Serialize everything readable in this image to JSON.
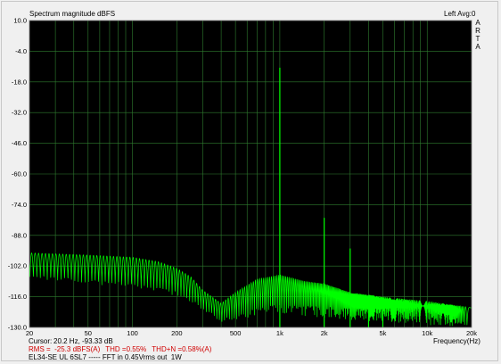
{
  "header": {
    "title": "Spectrum magnitude dBFS",
    "channel": "Left  Avg:0",
    "brand": [
      "A",
      "R",
      "T",
      "A"
    ]
  },
  "chart_data": {
    "type": "line",
    "title": "Spectrum magnitude dBFS",
    "xlabel": "Frequency(Hz)",
    "ylabel": "",
    "x_scale": "log",
    "xlim": [
      20,
      20000
    ],
    "ylim": [
      -130,
      10
    ],
    "grid": true,
    "y_ticks": [
      "10.0",
      "-4.0",
      "-18.0",
      "-32.0",
      "-46.0",
      "-60.0",
      "-74.0",
      "-88.0",
      "-102.0",
      "-116.0",
      "-130.0"
    ],
    "x_ticks": [
      {
        "v": 20,
        "label": "20"
      },
      {
        "v": 50,
        "label": "50"
      },
      {
        "v": 100,
        "label": "100"
      },
      {
        "v": 200,
        "label": "200"
      },
      {
        "v": 500,
        "label": "500"
      },
      {
        "v": 1000,
        "label": "1k"
      },
      {
        "v": 2000,
        "label": "2k"
      },
      {
        "v": 5000,
        "label": "5k"
      },
      {
        "v": 10000,
        "label": "10k"
      },
      {
        "v": 20000,
        "label": "20k"
      }
    ],
    "series": [
      {
        "color": "#00ff00",
        "floor": [
          [
            20,
            -108
          ],
          [
            100,
            -112
          ],
          [
            200,
            -116
          ],
          [
            300,
            -122
          ],
          [
            400,
            -128
          ],
          [
            600,
            -126
          ],
          [
            1000,
            -124
          ],
          [
            2000,
            -126
          ],
          [
            5000,
            -128
          ],
          [
            10000,
            -129
          ],
          [
            20000,
            -130
          ]
        ],
        "peaks": [
          [
            20,
            -96
          ],
          [
            50,
            -97
          ],
          [
            100,
            -98
          ],
          [
            150,
            -100
          ],
          [
            200,
            -103
          ],
          [
            250,
            -107
          ],
          [
            300,
            -113
          ],
          [
            400,
            -119
          ],
          [
            500,
            -114
          ],
          [
            700,
            -108
          ],
          [
            1000,
            -106
          ],
          [
            1500,
            -109
          ],
          [
            2000,
            -110
          ],
          [
            3000,
            -114
          ],
          [
            5000,
            -116
          ],
          [
            10000,
            -118
          ],
          [
            20000,
            -121
          ]
        ],
        "harmonics": [
          [
            1000,
            -11.5
          ],
          [
            2000,
            -80.0
          ],
          [
            3000,
            -94.0
          ],
          [
            4000,
            -118.0
          ],
          [
            5000,
            -122.0
          ]
        ]
      }
    ]
  },
  "readout": {
    "cursor_label": "Cursor:",
    "cursor_value": "20.2 Hz, -93.33 dB",
    "rms": "RMS =  -25.3 dBFS(A)",
    "thd": "THD =0.55%",
    "thdn": "THD+N =0.58%(A)",
    "description": "EL34-SE UL 6SL7 ----- FFT in 0.45Vrms out  1W"
  }
}
